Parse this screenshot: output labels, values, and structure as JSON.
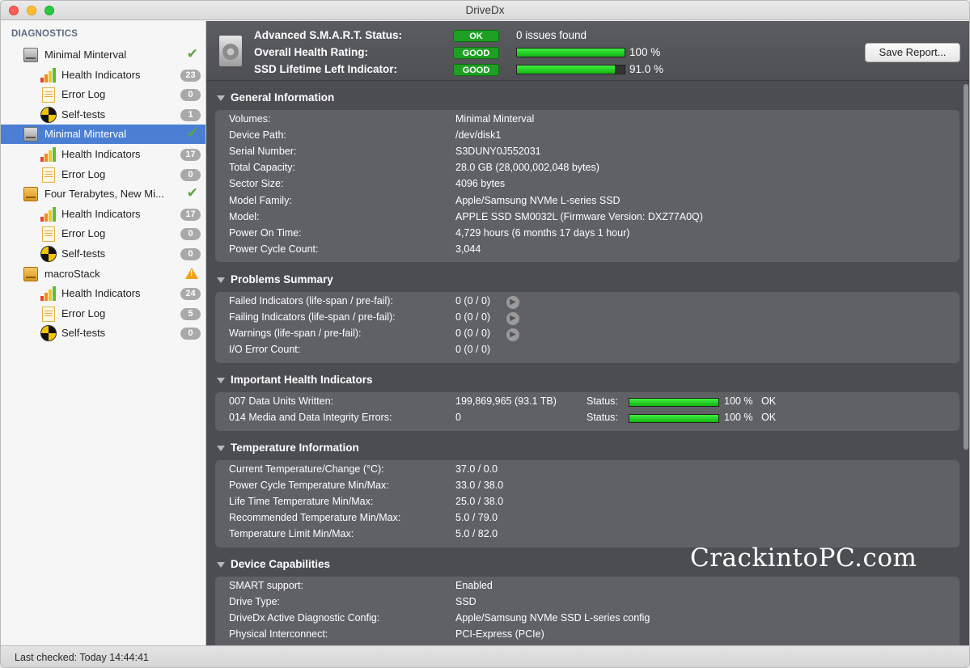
{
  "window": {
    "title": "DriveDx"
  },
  "sidebar": {
    "heading": "DIAGNOSTICS",
    "rows": [
      {
        "label": "Minimal Minterval",
        "type": "drive-gray",
        "status": "check"
      },
      {
        "label": "Health Indicators",
        "type": "bars",
        "count": "23"
      },
      {
        "label": "Error Log",
        "type": "log",
        "count": "0"
      },
      {
        "label": "Self-tests",
        "type": "test",
        "count": "1"
      },
      {
        "label": "Minimal Minterval",
        "type": "drive-gray",
        "status": "check",
        "selected": true
      },
      {
        "label": "Health Indicators",
        "type": "bars",
        "count": "17"
      },
      {
        "label": "Error Log",
        "type": "log",
        "count": "0"
      },
      {
        "label": "Four Terabytes, New Mi...",
        "type": "drive-orange",
        "status": "check"
      },
      {
        "label": "Health Indicators",
        "type": "bars",
        "count": "17"
      },
      {
        "label": "Error Log",
        "type": "log",
        "count": "0"
      },
      {
        "label": "Self-tests",
        "type": "test",
        "count": "0"
      },
      {
        "label": "macroStack",
        "type": "drive-orange",
        "status": "warning"
      },
      {
        "label": "Health Indicators",
        "type": "bars",
        "count": "24"
      },
      {
        "label": "Error Log",
        "type": "log",
        "count": "5"
      },
      {
        "label": "Self-tests",
        "type": "test",
        "count": "0"
      }
    ]
  },
  "header": {
    "smart_label": "Advanced S.M.A.R.T. Status:",
    "smart_pill": "OK",
    "smart_text": "0 issues found",
    "health_label": "Overall Health Rating:",
    "health_pill": "GOOD",
    "health_value": "100 %",
    "health_fraction": 1.0,
    "lifetime_label": "SSD Lifetime Left Indicator:",
    "lifetime_pill": "GOOD",
    "lifetime_value": "91.0 %",
    "lifetime_fraction": 0.91,
    "save_button": "Save Report..."
  },
  "general": {
    "title": "General Information",
    "rows": [
      {
        "label": "Volumes:",
        "value": "Minimal Minterval"
      },
      {
        "label": "Device Path:",
        "value": "/dev/disk1"
      },
      {
        "label": "Serial Number:",
        "value": "S3DUNY0J552031"
      },
      {
        "label": "Total Capacity:",
        "value": "28.0 GB (28,000,002,048 bytes)"
      },
      {
        "label": "Sector Size:",
        "value": "4096 bytes"
      },
      {
        "label": "Model Family:",
        "value": "Apple/Samsung NVMe L-series SSD"
      },
      {
        "label": "Model:",
        "value": "APPLE SSD SM0032L  (Firmware Version: DXZ77A0Q)"
      },
      {
        "label": "Power On Time:",
        "value": "4,729 hours (6 months 17 days 1 hour)"
      },
      {
        "label": "Power Cycle Count:",
        "value": "3,044"
      }
    ]
  },
  "problems": {
    "title": "Problems Summary",
    "rows": [
      {
        "label": "Failed Indicators (life-span / pre-fail):",
        "value": "0 (0 / 0)",
        "arrow": true
      },
      {
        "label": "Failing Indicators (life-span / pre-fail):",
        "value": "0 (0 / 0)",
        "arrow": true
      },
      {
        "label": "Warnings (life-span / pre-fail):",
        "value": "0 (0 / 0)",
        "arrow": true
      },
      {
        "label": "I/O Error Count:",
        "value": "0 (0 / 0)",
        "arrow": false
      }
    ]
  },
  "health": {
    "title": "Important Health Indicators",
    "status_label": "Status:",
    "rows": [
      {
        "label": "007  Data Units Written:",
        "value": "199,869,965 (93.1 TB)",
        "pct": "100 %",
        "fraction": 1.0,
        "state": "OK"
      },
      {
        "label": "014  Media and Data Integrity Errors:",
        "value": "0",
        "pct": "100 %",
        "fraction": 1.0,
        "state": "OK"
      }
    ]
  },
  "temperature": {
    "title": "Temperature Information",
    "rows": [
      {
        "label": "Current Temperature/Change (°C):",
        "value": "37.0 / 0.0"
      },
      {
        "label": "Power Cycle Temperature Min/Max:",
        "value": "33.0 / 38.0"
      },
      {
        "label": "Life Time Temperature Min/Max:",
        "value": "25.0 / 38.0"
      },
      {
        "label": "Recommended Temperature Min/Max:",
        "value": "5.0   / 79.0"
      },
      {
        "label": "Temperature Limit Min/Max:",
        "value": "5.0   / 82.0"
      }
    ]
  },
  "capabilities": {
    "title": "Device Capabilities",
    "rows": [
      {
        "label": "SMART support:",
        "value": "Enabled"
      },
      {
        "label": "Drive Type:",
        "value": "SSD"
      },
      {
        "label": "DriveDx Active Diagnostic Config:",
        "value": "Apple/Samsung NVMe SSD L-series config"
      },
      {
        "label": "Physical Interconnect:",
        "value": "PCI-Express (PCIe)"
      }
    ]
  },
  "watermark": "CrackintoPC.com",
  "statusbar": {
    "text": "Last checked: Today 14:44:41"
  },
  "colors": {
    "accent": "#4a7fd4",
    "good": "#1f9f24",
    "panel": "#5f6165",
    "background": "#4b4d50"
  }
}
